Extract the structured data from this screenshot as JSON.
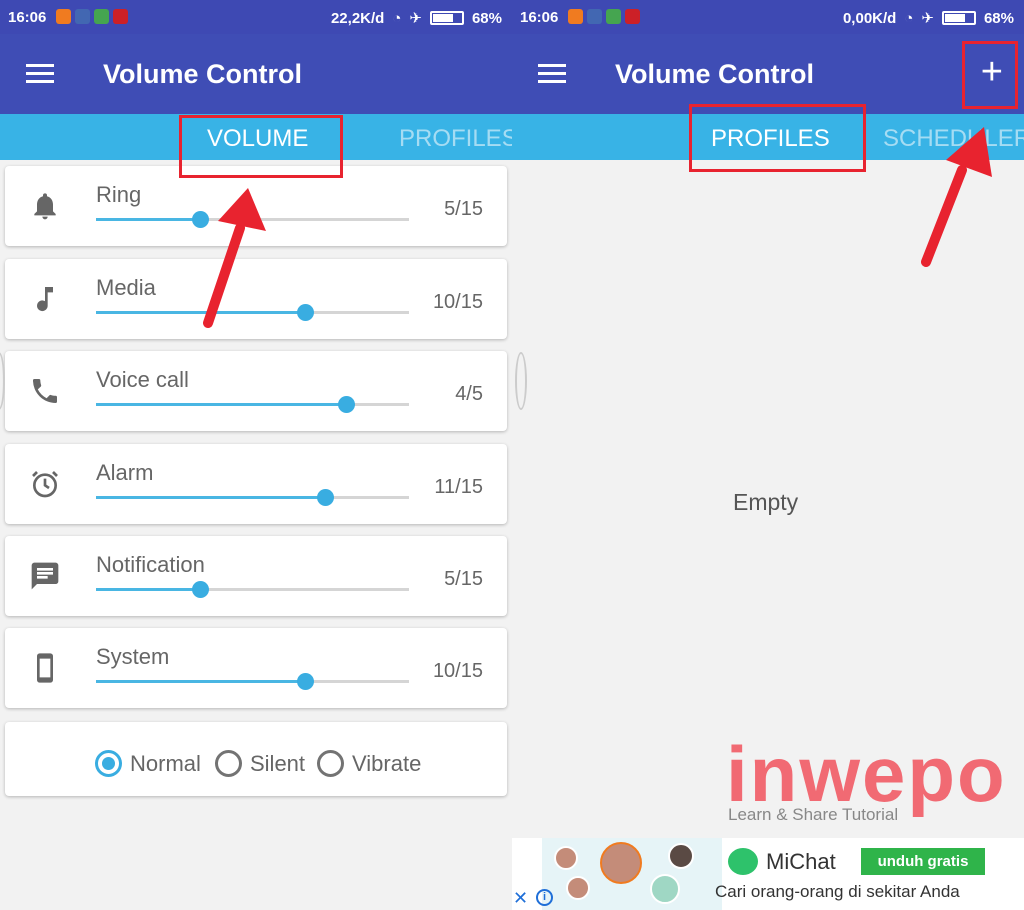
{
  "left": {
    "status": {
      "time": "16:06",
      "speed": "22,2K/d",
      "battery": "68%"
    },
    "appbar": {
      "title": "Volume Control"
    },
    "tabs": [
      {
        "label": "VOLUME"
      },
      {
        "label": "PROFILESVOLUME"
      }
    ],
    "volumes": [
      {
        "label": "Ring",
        "value": "5/15",
        "fraction": 0.333,
        "icon": "bell-icon"
      },
      {
        "label": "Media",
        "value": "10/15",
        "fraction": 0.667,
        "icon": "music-note-icon"
      },
      {
        "label": "Voice call",
        "value": "4/5",
        "fraction": 0.8,
        "icon": "phone-icon"
      },
      {
        "label": "Alarm",
        "value": "11/15",
        "fraction": 0.733,
        "icon": "alarm-clock-icon"
      },
      {
        "label": "Notification",
        "value": "5/15",
        "fraction": 0.333,
        "icon": "message-icon"
      },
      {
        "label": "System",
        "value": "10/15",
        "fraction": 0.667,
        "icon": "smartphone-icon"
      }
    ],
    "modes": [
      {
        "label": "Normal"
      },
      {
        "label": "Silent"
      },
      {
        "label": "Vibrate"
      }
    ],
    "selected_mode": "Normal"
  },
  "right": {
    "status": {
      "time": "16:06",
      "speed": "0,00K/d",
      "battery": "68%"
    },
    "appbar": {
      "title": "Volume Control",
      "add": "+"
    },
    "tabs": [
      {
        "label": "PROFILES"
      },
      {
        "label": "SCHEDULER"
      }
    ],
    "empty_text": "Empty",
    "watermark": {
      "word": "inwepo",
      "tagline": "Learn & Share Tutorial"
    },
    "ad": {
      "brand": "MiChat",
      "cta": "unduh gratis",
      "text": "Cari orang-orang di sekitar Anda"
    }
  },
  "colors": {
    "appbar": "#3f4db5",
    "tabbar": "#38b3e6",
    "accent": "#39ade1",
    "annotation": "#e8232f"
  }
}
